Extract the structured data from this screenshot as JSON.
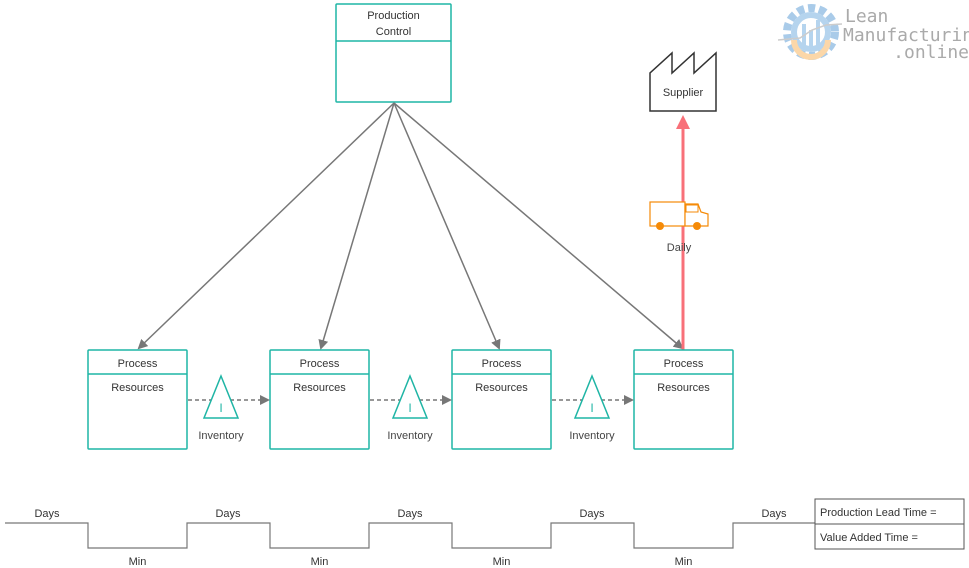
{
  "logo": {
    "line1": "Lean",
    "line2": "Manufacturing",
    "line3": ".online"
  },
  "production_control": {
    "line1": "Production",
    "line2": "Control"
  },
  "supplier": {
    "label": "Supplier"
  },
  "shipment": {
    "frequency": "Daily",
    "icon": "truck-icon",
    "arrow_color": "#f87079"
  },
  "processes": [
    {
      "title": "Process",
      "body": "Resources"
    },
    {
      "title": "Process",
      "body": "Resources"
    },
    {
      "title": "Process",
      "body": "Resources"
    },
    {
      "title": "Process",
      "body": "Resources"
    }
  ],
  "inventories": [
    {
      "symbol": "I",
      "label": "Inventory"
    },
    {
      "symbol": "I",
      "label": "Inventory"
    },
    {
      "symbol": "I",
      "label": "Inventory"
    }
  ],
  "timeline": {
    "days": [
      "Days",
      "Days",
      "Days",
      "Days",
      "Days"
    ],
    "mins": [
      "Min",
      "Min",
      "Min",
      "Min"
    ]
  },
  "summary": {
    "lead_time": "Production Lead Time =",
    "value_added": "Value Added Time ="
  },
  "colors": {
    "accent": "#1fb5a5",
    "truck": "#f58a07",
    "arrow": "#f87079"
  }
}
